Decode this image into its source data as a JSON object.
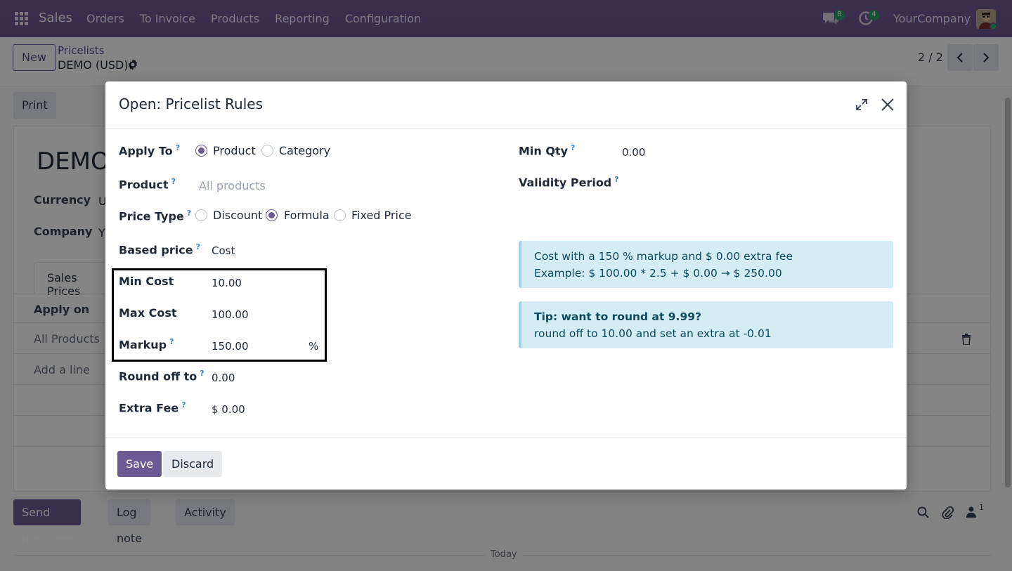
{
  "navbar": {
    "app_name": "Sales",
    "menu": [
      "Orders",
      "To Invoice",
      "Products",
      "Reporting",
      "Configuration"
    ],
    "messages_badge": "8",
    "activities_badge": "4",
    "company": "YourCompany"
  },
  "control_panel": {
    "new_label": "New",
    "breadcrumb_parent": "Pricelists",
    "breadcrumb_current": "DEMO (USD)",
    "pager": "2 / 2"
  },
  "background_form": {
    "print_label": "Print",
    "title": "DEMO",
    "currency_label": "Currency",
    "currency_value": "U",
    "company_label": "Company",
    "company_value": "Y",
    "tab_sales_prices": "Sales Prices",
    "col_apply_on": "Apply on",
    "row_all_products": "All Products",
    "add_line": "Add a line",
    "send_message": "Send message",
    "log_note": "Log note",
    "activity": "Activity",
    "followers_count": "1",
    "today": "Today"
  },
  "modal": {
    "title": "Open: Pricelist Rules",
    "apply_to_label": "Apply To",
    "apply_to_options": [
      "Product",
      "Category"
    ],
    "apply_to_selected": "Product",
    "product_label": "Product",
    "product_placeholder": "All products",
    "price_type_label": "Price Type",
    "price_type_options": [
      "Discount",
      "Formula",
      "Fixed Price"
    ],
    "price_type_selected": "Formula",
    "based_price_label": "Based price",
    "based_price_value": "Cost",
    "min_cost_label": "Min Cost",
    "min_cost_value": "10.00",
    "max_cost_label": "Max Cost",
    "max_cost_value": "100.00",
    "markup_label": "Markup",
    "markup_value": "150.00",
    "markup_unit": "%",
    "round_off_label": "Round off to",
    "round_off_value": "0.00",
    "extra_fee_label": "Extra Fee",
    "extra_fee_value": "$ 0.00",
    "min_qty_label": "Min Qty",
    "min_qty_value": "0.00",
    "validity_label": "Validity Period",
    "info_line1": "Cost with a 150 % markup and $ 0.00 extra fee",
    "info_line2": "Example: $ 100.00 * 2.5 + $ 0.00 → $ 250.00",
    "tip_title": "Tip: want to round at 9.99?",
    "tip_body": "round off to 10.00 and set an extra at -0.01",
    "save_label": "Save",
    "discard_label": "Discard",
    "help_mark": "?"
  }
}
